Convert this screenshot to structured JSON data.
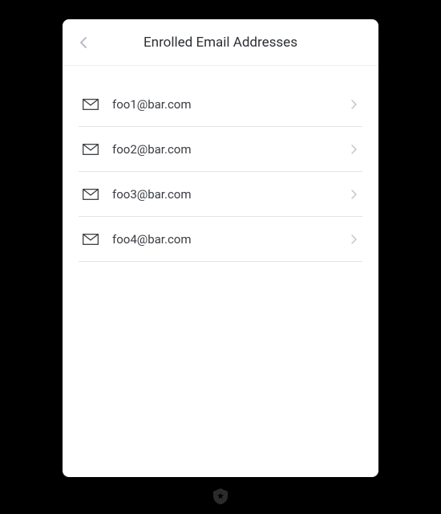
{
  "header": {
    "title": "Enrolled Email Addresses"
  },
  "emails": [
    {
      "address": "foo1@bar.com"
    },
    {
      "address": "foo2@bar.com"
    },
    {
      "address": "foo3@bar.com"
    },
    {
      "address": "foo4@bar.com"
    }
  ]
}
